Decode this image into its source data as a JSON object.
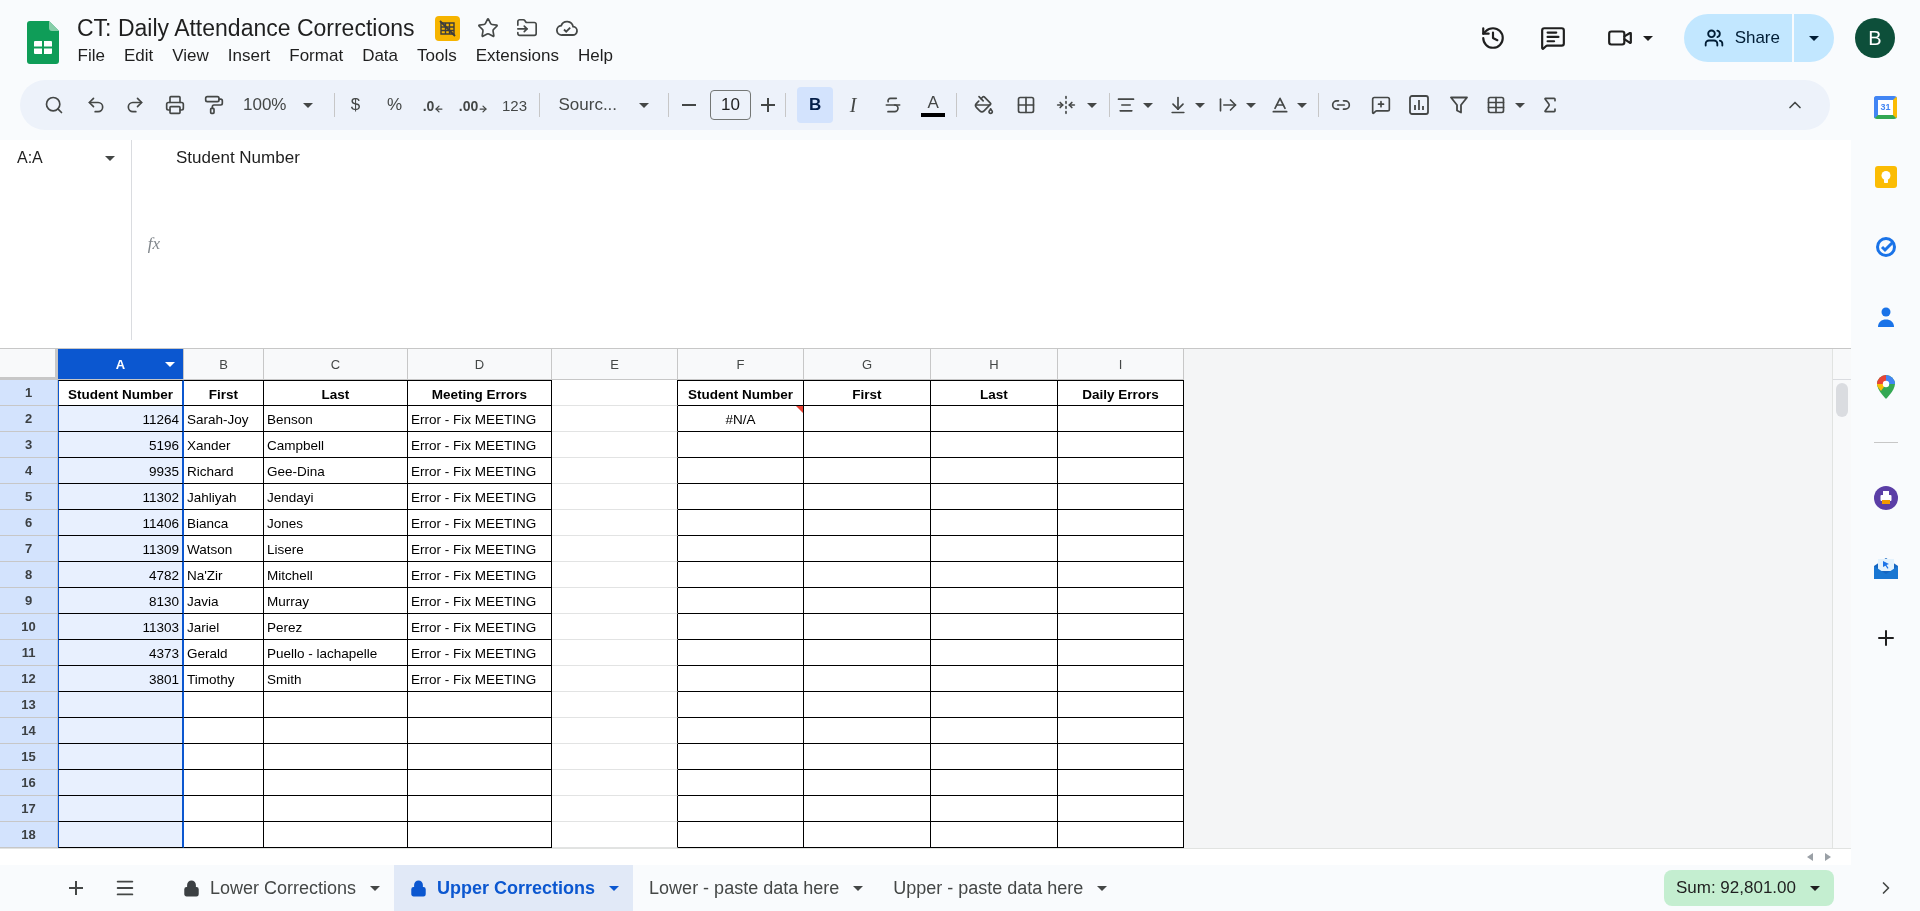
{
  "document": {
    "title": "CT: Daily Attendance Corrections"
  },
  "menu": [
    "File",
    "Edit",
    "View",
    "Insert",
    "Format",
    "Data",
    "Tools",
    "Extensions",
    "Help"
  ],
  "share_button": {
    "label": "Share"
  },
  "account": {
    "initial": "B"
  },
  "toolbar": {
    "zoom": "100%",
    "currency": "$",
    "percent": "%",
    "decrease_decimal": ".0",
    "increase_decimal": ".00",
    "number_format": "123",
    "font": "Sourc...",
    "font_size": "10",
    "bold": {
      "label": "B",
      "selected": true
    },
    "italic": {
      "label": "I",
      "selected": false
    },
    "text_color": "A"
  },
  "formula_bar": {
    "name_box": "A:A",
    "fx": "fx",
    "content": "Student Number"
  },
  "grid": {
    "columns": [
      {
        "letter": "A",
        "selected": true,
        "bordered": true
      },
      {
        "letter": "B",
        "selected": false,
        "bordered": true
      },
      {
        "letter": "C",
        "selected": false,
        "bordered": true
      },
      {
        "letter": "D",
        "selected": false,
        "bordered": true
      },
      {
        "letter": "E",
        "selected": false,
        "bordered": false
      },
      {
        "letter": "F",
        "selected": false,
        "bordered": true
      },
      {
        "letter": "G",
        "selected": false,
        "bordered": true
      },
      {
        "letter": "H",
        "selected": false,
        "bordered": true
      },
      {
        "letter": "I",
        "selected": false,
        "bordered": true
      }
    ],
    "rows": [
      {
        "number": "1",
        "has_active_cell": true,
        "cells": [
          {
            "kind": "header",
            "text": "Student Number"
          },
          {
            "kind": "header",
            "text": "First"
          },
          {
            "kind": "header",
            "text": "Last"
          },
          {
            "kind": "header",
            "text": "Meeting Errors"
          },
          null,
          {
            "kind": "header",
            "text": "Student Number"
          },
          {
            "kind": "header",
            "text": "First"
          },
          {
            "kind": "header",
            "text": "Last"
          },
          {
            "kind": "header",
            "text": "Daily Errors"
          }
        ]
      },
      {
        "number": "2",
        "has_active_cell": false,
        "cells": [
          {
            "kind": "number",
            "text": "11264"
          },
          {
            "kind": "text",
            "text": "Sarah-Joy"
          },
          {
            "kind": "text",
            "text": "Benson"
          },
          {
            "kind": "text",
            "text": "Error - Fix MEETING"
          },
          null,
          {
            "kind": "error",
            "text": "#N/A"
          }
        ]
      },
      {
        "number": "3",
        "has_active_cell": false,
        "cells": [
          {
            "kind": "number",
            "text": "5196"
          },
          {
            "kind": "text",
            "text": "Xander"
          },
          {
            "kind": "text",
            "text": "Campbell"
          },
          {
            "kind": "text",
            "text": "Error - Fix MEETING"
          }
        ]
      },
      {
        "number": "4",
        "has_active_cell": false,
        "cells": [
          {
            "kind": "number",
            "text": "9935"
          },
          {
            "kind": "text",
            "text": "Richard"
          },
          {
            "kind": "text",
            "text": "Gee-Dina"
          },
          {
            "kind": "text",
            "text": "Error - Fix MEETING"
          }
        ]
      },
      {
        "number": "5",
        "has_active_cell": false,
        "cells": [
          {
            "kind": "number",
            "text": "11302"
          },
          {
            "kind": "text",
            "text": "Jahliyah"
          },
          {
            "kind": "text",
            "text": "Jendayi"
          },
          {
            "kind": "text",
            "text": "Error - Fix MEETING"
          }
        ]
      },
      {
        "number": "6",
        "has_active_cell": false,
        "cells": [
          {
            "kind": "number",
            "text": "11406"
          },
          {
            "kind": "text",
            "text": "Bianca"
          },
          {
            "kind": "text",
            "text": "Jones"
          },
          {
            "kind": "text",
            "text": "Error - Fix MEETING"
          }
        ]
      },
      {
        "number": "7",
        "has_active_cell": false,
        "cells": [
          {
            "kind": "number",
            "text": "11309"
          },
          {
            "kind": "text",
            "text": "Watson"
          },
          {
            "kind": "text",
            "text": "Lisere"
          },
          {
            "kind": "text",
            "text": "Error - Fix MEETING"
          }
        ]
      },
      {
        "number": "8",
        "has_active_cell": false,
        "cells": [
          {
            "kind": "number",
            "text": "4782"
          },
          {
            "kind": "text",
            "text": "Na'Zir"
          },
          {
            "kind": "text",
            "text": "Mitchell"
          },
          {
            "kind": "text",
            "text": "Error - Fix MEETING"
          }
        ]
      },
      {
        "number": "9",
        "has_active_cell": false,
        "cells": [
          {
            "kind": "number",
            "text": "8130"
          },
          {
            "kind": "text",
            "text": "Javia"
          },
          {
            "kind": "text",
            "text": "Murray"
          },
          {
            "kind": "text",
            "text": "Error - Fix MEETING"
          }
        ]
      },
      {
        "number": "10",
        "has_active_cell": false,
        "cells": [
          {
            "kind": "number",
            "text": "11303"
          },
          {
            "kind": "text",
            "text": "Jariel"
          },
          {
            "kind": "text",
            "text": "Perez"
          },
          {
            "kind": "text",
            "text": "Error - Fix MEETING"
          }
        ]
      },
      {
        "number": "11",
        "has_active_cell": false,
        "cells": [
          {
            "kind": "number",
            "text": "4373"
          },
          {
            "kind": "text",
            "text": "Gerald"
          },
          {
            "kind": "text",
            "text": "Puello - lachapelle"
          },
          {
            "kind": "text",
            "text": "Error - Fix MEETING"
          }
        ]
      },
      {
        "number": "12",
        "has_active_cell": false,
        "cells": [
          {
            "kind": "number",
            "text": "3801"
          },
          {
            "kind": "text",
            "text": "Timothy"
          },
          {
            "kind": "text",
            "text": "Smith"
          },
          {
            "kind": "text",
            "text": "Error - Fix MEETING"
          }
        ]
      },
      {
        "number": "13",
        "has_active_cell": false
      },
      {
        "number": "14",
        "has_active_cell": false
      },
      {
        "number": "15",
        "has_active_cell": false
      },
      {
        "number": "16",
        "has_active_cell": false
      },
      {
        "number": "17",
        "has_active_cell": false
      },
      {
        "number": "18",
        "has_active_cell": false
      }
    ]
  },
  "sheet_tabs": [
    {
      "label": "Lower Corrections",
      "locked": true,
      "selected": false
    },
    {
      "label": "Upper Corrections",
      "locked": true,
      "selected": true
    },
    {
      "label": "Lower - paste data here",
      "locked": false,
      "selected": false
    },
    {
      "label": "Upper - paste data here",
      "locked": false,
      "selected": false
    }
  ],
  "sum": {
    "label": "Sum: 92,801.00"
  },
  "side_panel": {
    "calendar_label": "31"
  }
}
